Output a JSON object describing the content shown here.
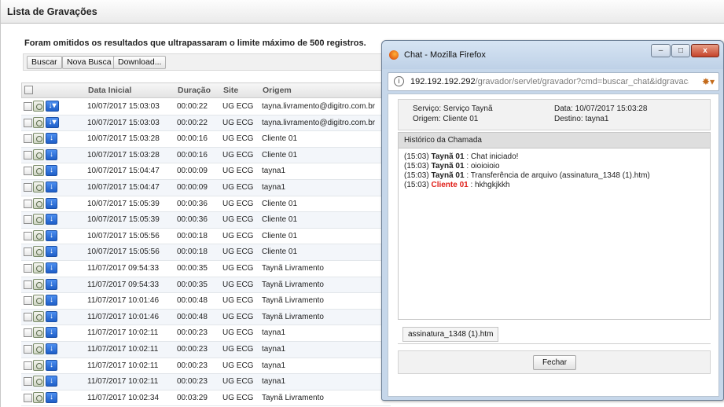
{
  "page": {
    "title": "Lista de Gravações",
    "notice": "Foram omitidos os resultados que ultrapassaram o limite máximo de 500 registros.",
    "toolbar": {
      "search": "Buscar",
      "new_search": "Nova Busca",
      "download": "Download..."
    }
  },
  "grid": {
    "columns": {
      "start_date": "Data Inicial",
      "duration": "Duração",
      "site": "Site",
      "origin": "Origem"
    },
    "rows": [
      {
        "date": "10/07/2017 15:03:03",
        "duration": "00:00:22",
        "site": "UG ECG",
        "origin": "tayna.livramento@digitro.com.br"
      },
      {
        "date": "10/07/2017 15:03:03",
        "duration": "00:00:22",
        "site": "UG ECG",
        "origin": "tayna.livramento@digitro.com.br"
      },
      {
        "date": "10/07/2017 15:03:28",
        "duration": "00:00:16",
        "site": "UG ECG",
        "origin": "Cliente 01"
      },
      {
        "date": "10/07/2017 15:03:28",
        "duration": "00:00:16",
        "site": "UG ECG",
        "origin": "Cliente 01"
      },
      {
        "date": "10/07/2017 15:04:47",
        "duration": "00:00:09",
        "site": "UG ECG",
        "origin": "tayna1"
      },
      {
        "date": "10/07/2017 15:04:47",
        "duration": "00:00:09",
        "site": "UG ECG",
        "origin": "tayna1"
      },
      {
        "date": "10/07/2017 15:05:39",
        "duration": "00:00:36",
        "site": "UG ECG",
        "origin": "Cliente 01"
      },
      {
        "date": "10/07/2017 15:05:39",
        "duration": "00:00:36",
        "site": "UG ECG",
        "origin": "Cliente 01"
      },
      {
        "date": "10/07/2017 15:05:56",
        "duration": "00:00:18",
        "site": "UG ECG",
        "origin": "Cliente 01"
      },
      {
        "date": "10/07/2017 15:05:56",
        "duration": "00:00:18",
        "site": "UG ECG",
        "origin": "Cliente 01"
      },
      {
        "date": "11/07/2017 09:54:33",
        "duration": "00:00:35",
        "site": "UG ECG",
        "origin": "Taynã Livramento"
      },
      {
        "date": "11/07/2017 09:54:33",
        "duration": "00:00:35",
        "site": "UG ECG",
        "origin": "Taynã Livramento"
      },
      {
        "date": "11/07/2017 10:01:46",
        "duration": "00:00:48",
        "site": "UG ECG",
        "origin": "Taynã Livramento"
      },
      {
        "date": "11/07/2017 10:01:46",
        "duration": "00:00:48",
        "site": "UG ECG",
        "origin": "Taynã Livramento"
      },
      {
        "date": "11/07/2017 10:02:11",
        "duration": "00:00:23",
        "site": "UG ECG",
        "origin": "tayna1"
      },
      {
        "date": "11/07/2017 10:02:11",
        "duration": "00:00:23",
        "site": "UG ECG",
        "origin": "tayna1"
      },
      {
        "date": "11/07/2017 10:02:11",
        "duration": "00:00:23",
        "site": "UG ECG",
        "origin": "tayna1"
      },
      {
        "date": "11/07/2017 10:02:11",
        "duration": "00:00:23",
        "site": "UG ECG",
        "origin": "tayna1"
      },
      {
        "date": "11/07/2017 10:02:34",
        "duration": "00:03:29",
        "site": "UG ECG",
        "origin": "Taynã Livramento"
      }
    ]
  },
  "popup": {
    "window_title": "Chat - Mozilla Firefox",
    "url_host": "192.192.192.292",
    "url_path": "/gravador/servlet/gravador?cmd=buscar_chat&idgravaca",
    "service": "Serviço: Serviço Taynã",
    "origin": "Origem: Cliente 01",
    "date": "Data: 10/07/2017 15:03:28",
    "destination": "Destino: tayna1",
    "history_title": "Histórico da Chamada",
    "messages": [
      {
        "time": "(15:03)",
        "who": "Taynã 01",
        "text": ": Chat iniciado!",
        "client": false
      },
      {
        "time": "(15:03)",
        "who": "Taynã 01",
        "text": ": oioioioio",
        "client": false
      },
      {
        "time": "(15:03)",
        "who": "Taynã 01",
        "text": ": Transferência de arquivo (assinatura_1348 (1).htm)",
        "client": false
      },
      {
        "time": "(15:03)",
        "who": "Cliente 01",
        "text": ": hkhgkjkkh",
        "client": true
      }
    ],
    "attachment": "assinatura_1348 (1).htm",
    "close_button": "Fechar"
  },
  "colors": {
    "client_name": "#e0201a",
    "row_stripe": "#f3f6fa",
    "window_frame": "#c6d7ea"
  },
  "icons": [
    "checkbox-icon",
    "recording-icon",
    "download-icon",
    "firefox-logo-icon",
    "info-icon",
    "extension-icon"
  ]
}
